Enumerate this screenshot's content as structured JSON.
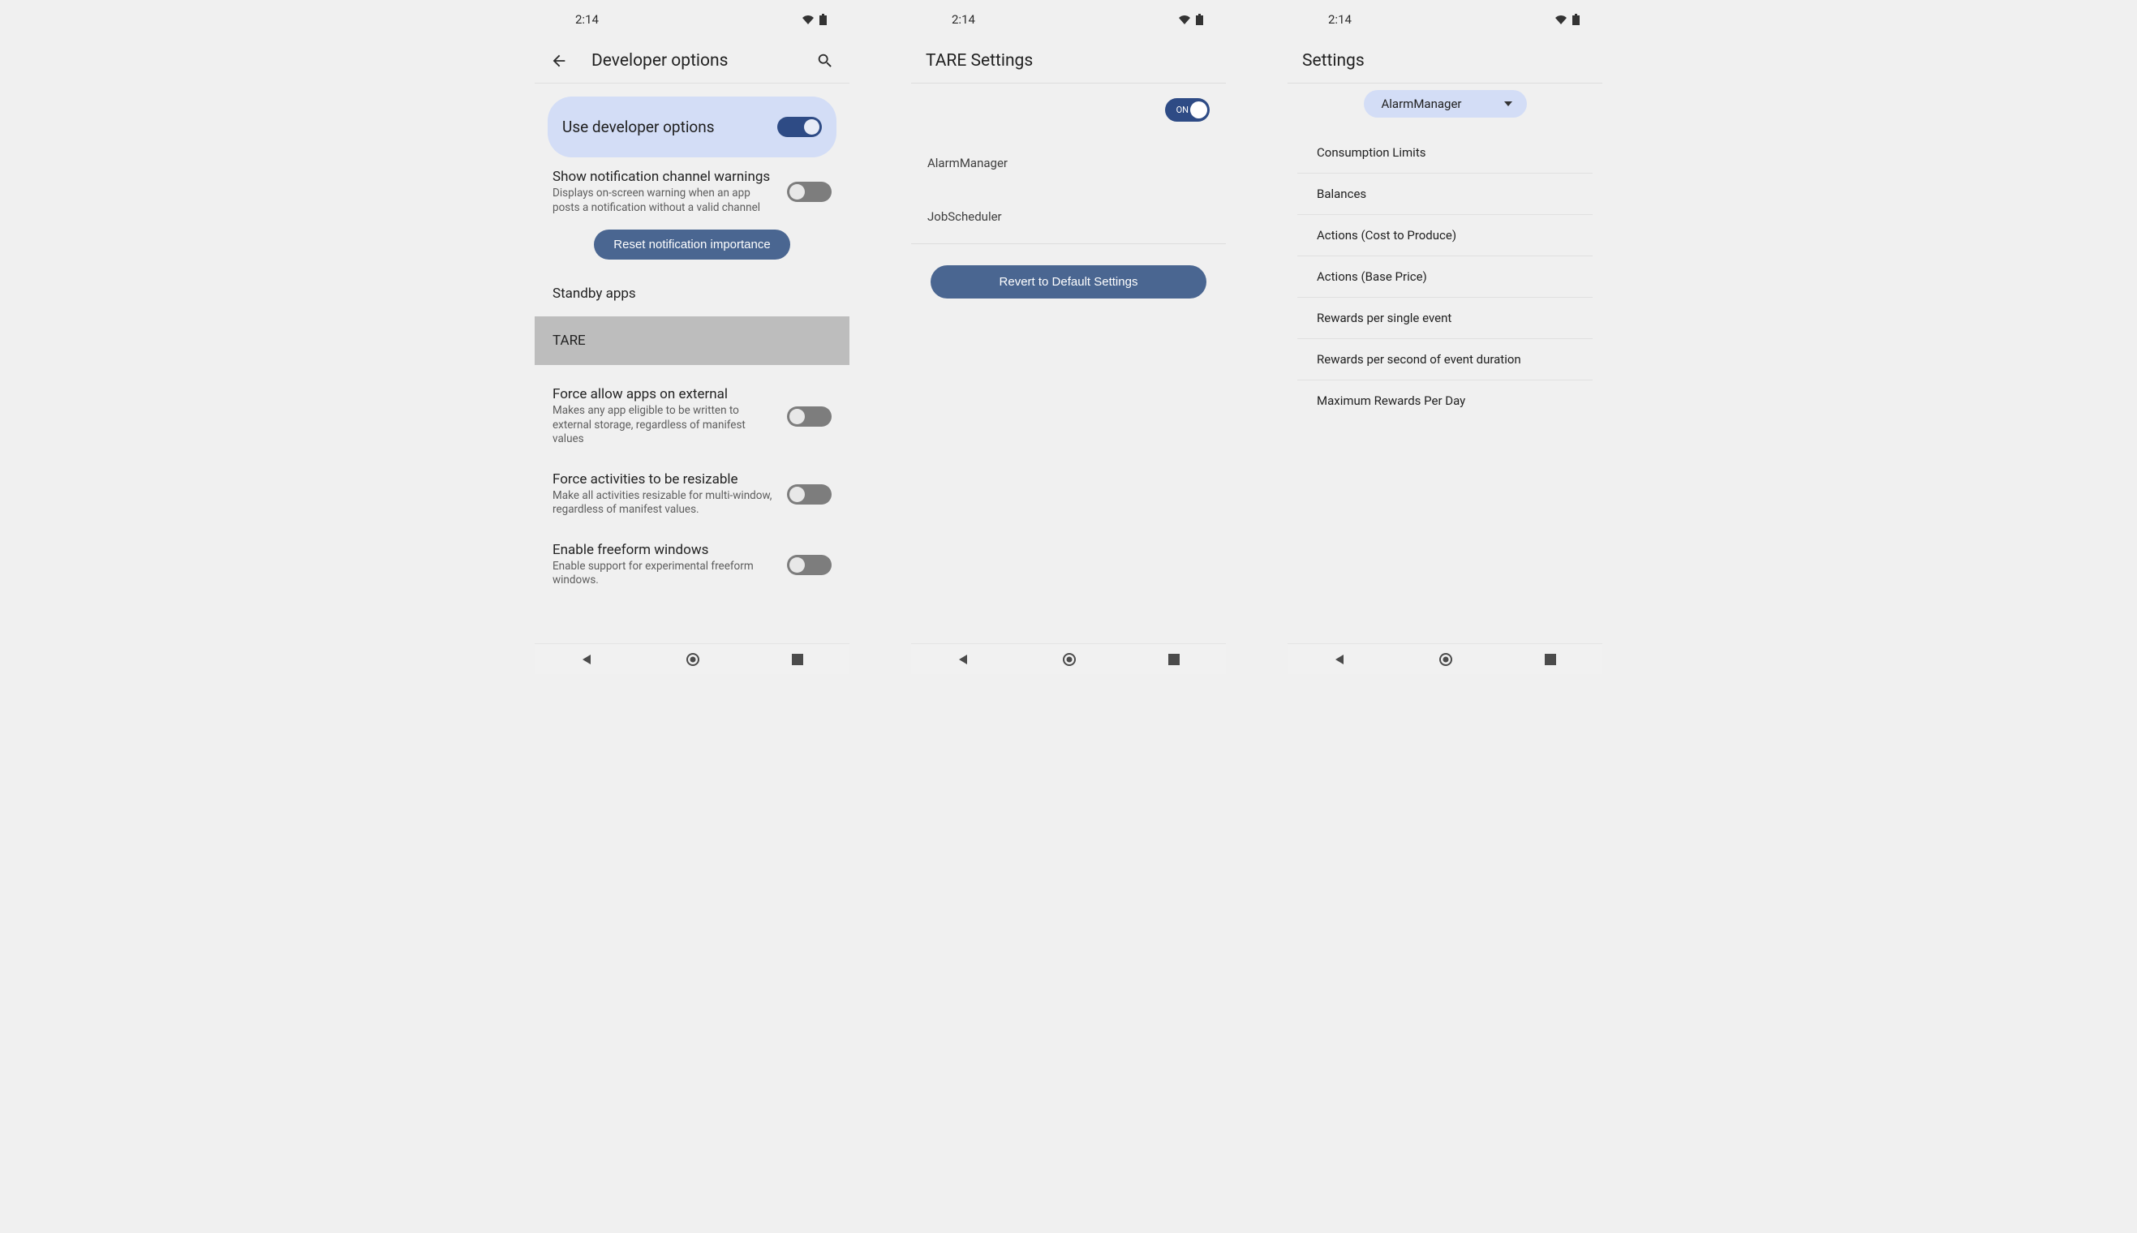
{
  "status": {
    "time": "2:14"
  },
  "screen1": {
    "title": "Developer options",
    "master_toggle": "Use developer options",
    "notif_warnings": {
      "title": "Show notification channel warnings",
      "sub": "Displays on-screen warning when an app posts a notification without a valid channel"
    },
    "reset_btn": "Reset notification importance",
    "standby": "Standby apps",
    "tare": "TARE",
    "external": {
      "title": "Force allow apps on external",
      "sub": "Makes any app eligible to be written to external storage, regardless of manifest values"
    },
    "resizable": {
      "title": "Force activities to be resizable",
      "sub": "Make all activities resizable for multi-window, regardless of manifest values."
    },
    "freeform": {
      "title": "Enable freeform windows",
      "sub": "Enable support for experimental freeform windows."
    }
  },
  "screen2": {
    "title": "TARE Settings",
    "toggle_label": "ON",
    "items": [
      "AlarmManager",
      "JobScheduler"
    ],
    "revert": "Revert to Default Settings"
  },
  "screen3": {
    "title": "Settings",
    "dropdown": "AlarmManager",
    "rows": [
      "Consumption Limits",
      "Balances",
      "Actions (Cost to Produce)",
      "Actions (Base Price)",
      "Rewards per single event",
      "Rewards per second of event duration",
      "Maximum Rewards Per Day"
    ]
  }
}
